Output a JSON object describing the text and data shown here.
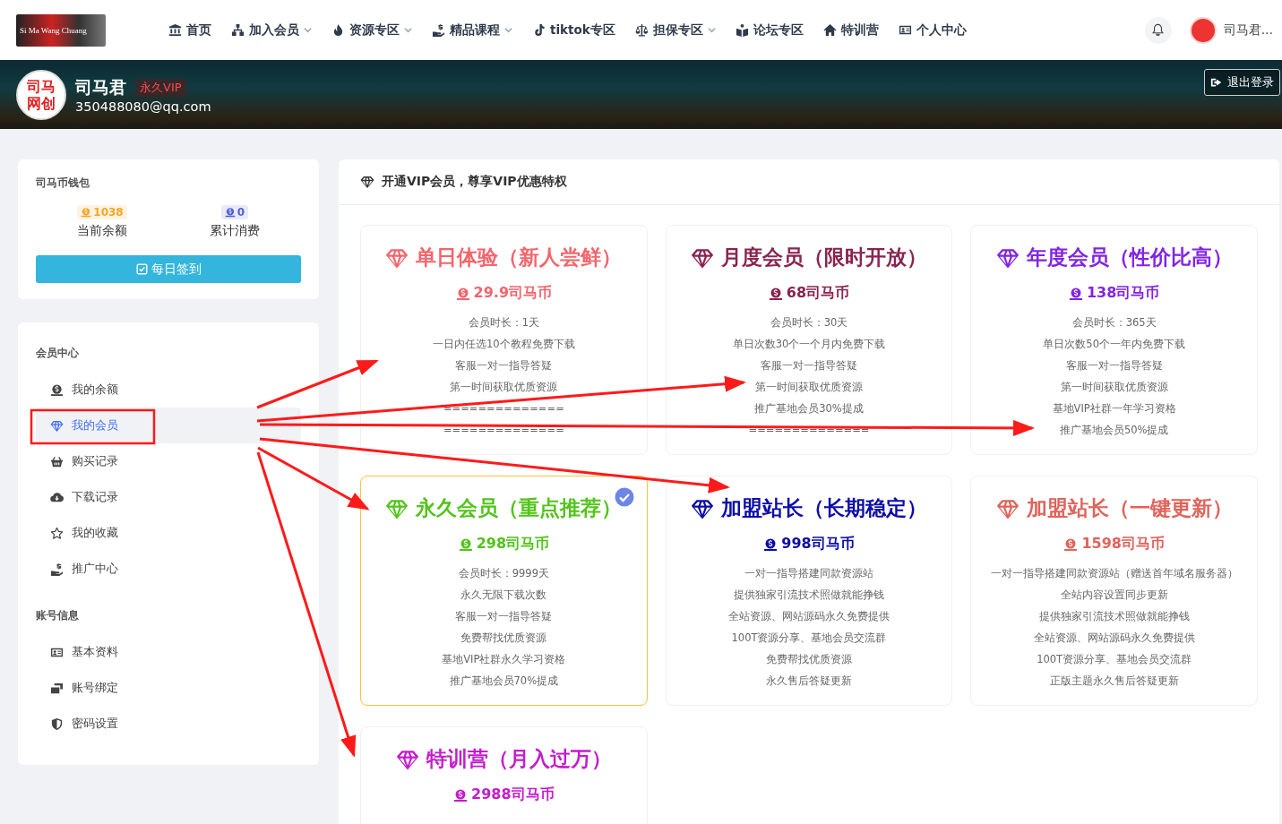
{
  "header": {
    "logo": {
      "tagline": "Si Ma Wang Chuang"
    },
    "nav": [
      {
        "label": "首页",
        "dropdown": false
      },
      {
        "label": "加入会员",
        "dropdown": true
      },
      {
        "label": "资源专区",
        "dropdown": true
      },
      {
        "label": "精品课程",
        "dropdown": true
      },
      {
        "label": "tiktok专区",
        "dropdown": false
      },
      {
        "label": "担保专区",
        "dropdown": true
      },
      {
        "label": "论坛专区",
        "dropdown": false
      },
      {
        "label": "特训营",
        "dropdown": false
      },
      {
        "label": "个人中心",
        "dropdown": false
      }
    ],
    "user_name": "司马君..."
  },
  "banner": {
    "avatar_text": [
      "司马",
      "网创"
    ],
    "name": "司马君",
    "vip_badge": "永久VIP",
    "email": "350488080@qq.com",
    "logout": "退出登录"
  },
  "wallet": {
    "title": "司马币钱包",
    "stats": [
      {
        "value": "1038",
        "label": "当前余额",
        "color": "#f5a623"
      },
      {
        "value": "0",
        "label": "累计消费",
        "color": "#4f5fd6"
      }
    ],
    "checkin": "每日签到"
  },
  "menu": [
    {
      "title": "会员中心",
      "items": [
        {
          "label": "我的余额",
          "selected": false
        },
        {
          "label": "我的会员",
          "selected": true
        },
        {
          "label": "购买记录",
          "selected": false
        },
        {
          "label": "下载记录",
          "selected": false
        },
        {
          "label": "我的收藏",
          "selected": false
        },
        {
          "label": "推广中心",
          "selected": false
        }
      ]
    },
    {
      "title": "账号信息",
      "items": [
        {
          "label": "基本资料",
          "selected": false
        },
        {
          "label": "账号绑定",
          "selected": false
        },
        {
          "label": "密码设置",
          "selected": false
        }
      ]
    }
  ],
  "vip_panel": {
    "title": "开通VIP会员，尊享VIP优惠特权",
    "plans": [
      {
        "name": "单日体验（新人尝鲜）",
        "price": "29.9司马币",
        "color": "#f5646b",
        "recommended": false,
        "features": [
          "会员时长：1天",
          "一日内任选10个教程免费下载",
          "客服一对一指导答疑",
          "第一时间获取优质资源",
          "==============",
          "=============="
        ]
      },
      {
        "name": "月度会员（限时开放）",
        "price": "68司马币",
        "color": "#8a2350",
        "recommended": false,
        "features": [
          "会员时长：30天",
          "单日次数30个一个月内免费下载",
          "客服一对一指导答疑",
          "第一时间获取优质资源",
          "推广基地会员30%提成",
          "=============="
        ]
      },
      {
        "name": "年度会员（性价比高）",
        "price": "138司马币",
        "color": "#8224e3",
        "recommended": false,
        "features": [
          "会员时长：365天",
          "单日次数50个一年内免费下载",
          "客服一对一指导答疑",
          "第一时间获取优质资源",
          "基地VIP社群一年学习资格",
          "推广基地会员50%提成"
        ]
      },
      {
        "name": "永久会员（重点推荐）",
        "price": "298司马币",
        "color": "#52c41a",
        "recommended": true,
        "features": [
          "会员时长：9999天",
          "永久无限下载次数",
          "客服一对一指导答疑",
          "免费帮找优质资源",
          "基地VIP社群永久学习资格",
          "推广基地会员70%提成"
        ]
      },
      {
        "name": "加盟站长（长期稳定）",
        "price": "998司马币",
        "color": "#0c0ca8",
        "recommended": false,
        "features": [
          "一对一指导搭建同款资源站",
          "提供独家引流技术照做就能挣钱",
          "全站资源、网站源码永久免费提供",
          "100T资源分享、基地会员交流群",
          "免费帮找优质资源",
          "永久售后答疑更新"
        ]
      },
      {
        "name": "加盟站长（一键更新）",
        "price": "1598司马币",
        "color": "#e0635a",
        "recommended": false,
        "features": [
          "一对一指导搭建同款资源站（赠送首年域名服务器）",
          "全站内容设置同步更新",
          "提供独家引流技术照做就能挣钱",
          "全站资源、网站源码永久免费提供",
          "100T资源分享、基地会员交流群",
          "正版主题永久售后答疑更新"
        ]
      },
      {
        "name": "特训营（月入过万）",
        "price": "2988司马币",
        "color": "#c41ccc",
        "recommended": false
      }
    ]
  }
}
